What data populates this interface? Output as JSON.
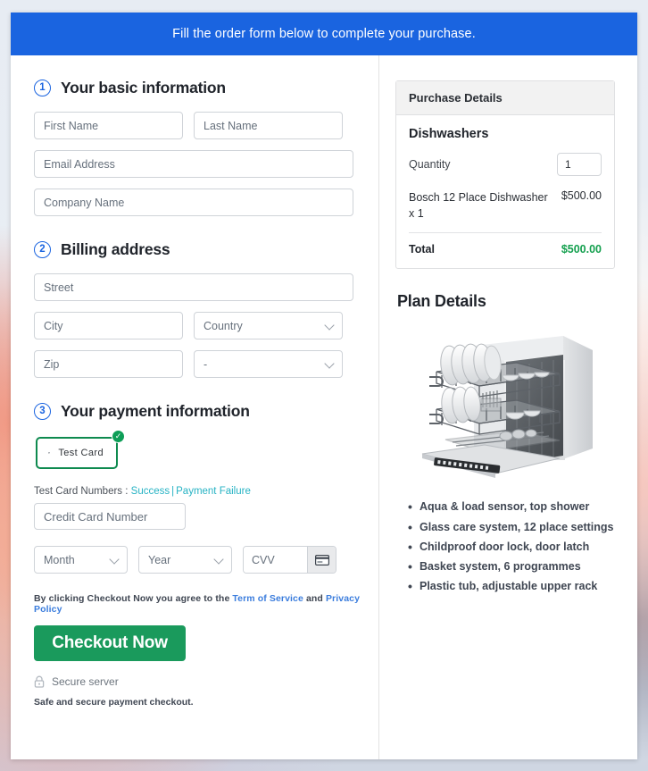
{
  "header": {
    "banner": "Fill the order form below to complete your purchase."
  },
  "sections": {
    "basic": {
      "number": "1",
      "title": "Your basic information"
    },
    "billing": {
      "number": "2",
      "title": "Billing address"
    },
    "payment": {
      "number": "3",
      "title": "Your payment information"
    }
  },
  "fields": {
    "first_name": "First Name",
    "last_name": "Last Name",
    "email": "Email Address",
    "company": "Company Name",
    "street": "Street",
    "city": "City",
    "country": "Country",
    "zip": "Zip",
    "state": "-",
    "credit_card": "Credit Card Number",
    "month": "Month",
    "year": "Year",
    "cvv": "CVV"
  },
  "payment": {
    "method_label": "Test Card",
    "method_selected": true,
    "check_glyph": "✓",
    "test_numbers_prefix": "Test Card Numbers : ",
    "test_success": "Success",
    "test_separator": "|",
    "test_failure": "Payment Failure",
    "terms_prefix": "By clicking Checkout Now you agree to the ",
    "terms_link": "Term of Service",
    "terms_middle": " and ",
    "privacy_link": "Privacy Policy",
    "checkout_button": "Checkout Now",
    "secure_server": "Secure server",
    "safe_note": "Safe and secure payment checkout."
  },
  "purchase": {
    "panel_title": "Purchase Details",
    "product": "Dishwashers",
    "quantity_label": "Quantity",
    "quantity_value": "1",
    "line_item": "Bosch 12 Place Dishwasher x 1",
    "line_amount": "$500.00",
    "total_label": "Total",
    "total_amount": "$500.00"
  },
  "plan": {
    "title": "Plan Details",
    "image_name": "dishwasher-product-image",
    "features": [
      "Aqua & load sensor, top shower",
      "Glass care system, 12 place settings",
      "Childproof door lock, door latch",
      "Basket system, 6 programmes",
      "Plastic tub, adjustable upper rack"
    ]
  },
  "colors": {
    "banner_blue": "#1a64e0",
    "accent_blue": "#3b7ddd",
    "success_green": "#15a04f",
    "button_green": "#1a9a5c",
    "card_border_green": "#0e8a4f",
    "link_teal": "#27b3c4"
  }
}
